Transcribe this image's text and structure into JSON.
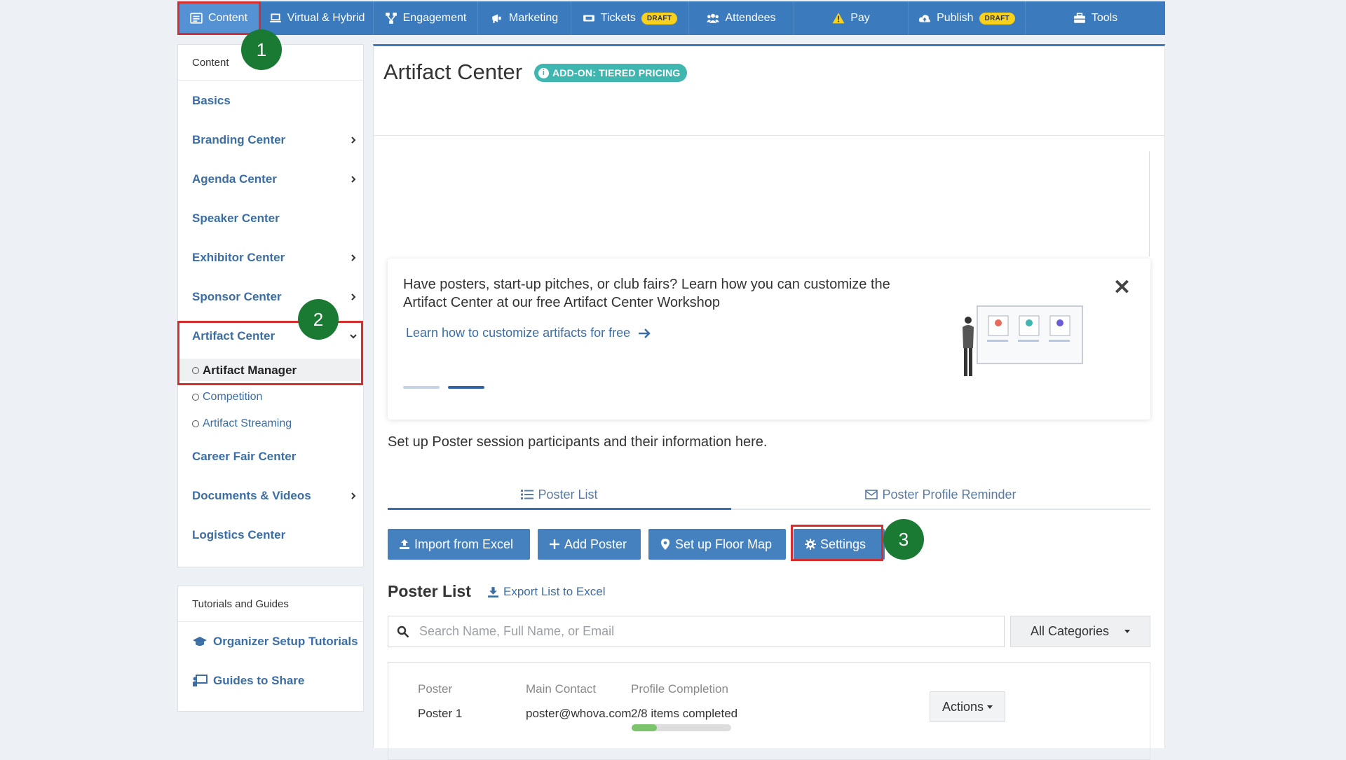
{
  "topnav": {
    "items": [
      {
        "label": "Content",
        "icon": "list-icon",
        "active": true
      },
      {
        "label": "Virtual & Hybrid",
        "icon": "laptop-icon"
      },
      {
        "label": "Engagement",
        "icon": "network-icon"
      },
      {
        "label": "Marketing",
        "icon": "megaphone-icon"
      },
      {
        "label": "Tickets",
        "icon": "ticket-icon",
        "badge": "DRAFT"
      },
      {
        "label": "Attendees",
        "icon": "users-icon"
      },
      {
        "label": "Pay",
        "icon": "warning-icon"
      },
      {
        "label": "Publish",
        "icon": "cloud-upload-icon",
        "badge": "DRAFT"
      },
      {
        "label": "Tools",
        "icon": "toolbox-icon"
      }
    ]
  },
  "sidebar": {
    "header": "Content",
    "items": [
      {
        "label": "Basics"
      },
      {
        "label": "Branding Center"
      },
      {
        "label": "Agenda Center"
      },
      {
        "label": "Speaker Center"
      },
      {
        "label": "Exhibitor Center"
      },
      {
        "label": "Sponsor Center"
      },
      {
        "label": "Artifact Center"
      },
      {
        "label": "Career Fair Center"
      },
      {
        "label": "Documents & Videos"
      },
      {
        "label": "Logistics Center"
      }
    ],
    "sub_items": [
      {
        "label": "Artifact Manager"
      },
      {
        "label": "Competition"
      },
      {
        "label": "Artifact Streaming"
      }
    ],
    "guides_header": "Tutorials and Guides",
    "guides": [
      {
        "label": "Organizer Setup Tutorials",
        "icon": "graduation-cap-icon"
      },
      {
        "label": "Guides to Share",
        "icon": "presentation-icon"
      }
    ]
  },
  "steps": [
    "1",
    "2",
    "3"
  ],
  "main": {
    "title": "Artifact Center",
    "addon_badge": "ADD-ON: TIERED PRICING",
    "promo": {
      "text": "Have posters, start-up pitches, or club fairs? Learn how you can customize the Artifact Center at our free Artifact Center Workshop",
      "link": "Learn how to customize artifacts for free",
      "close": "✕"
    },
    "intro": "Set up Poster session participants and their information here.",
    "tabs": [
      {
        "label": "Poster List",
        "icon": "list-icon",
        "active": true
      },
      {
        "label": "Poster Profile Reminder",
        "icon": "envelope-icon"
      }
    ],
    "buttons": {
      "import": "Import from Excel",
      "add": "Add Poster",
      "floor_map": "Set up Floor Map",
      "settings": "Settings"
    },
    "list_title": "Poster List",
    "export_label": "Export List to Excel",
    "search_placeholder": "Search Name, Full Name, or Email",
    "category_select": "All Categories",
    "table": {
      "headers": [
        "Poster",
        "Main Contact",
        "Profile Completion"
      ],
      "rows": [
        {
          "poster": "Poster 1",
          "contact": "poster@whova.com",
          "completion": "2/8 items completed",
          "progress": 0.25
        }
      ],
      "actions_label": "Actions"
    }
  }
}
